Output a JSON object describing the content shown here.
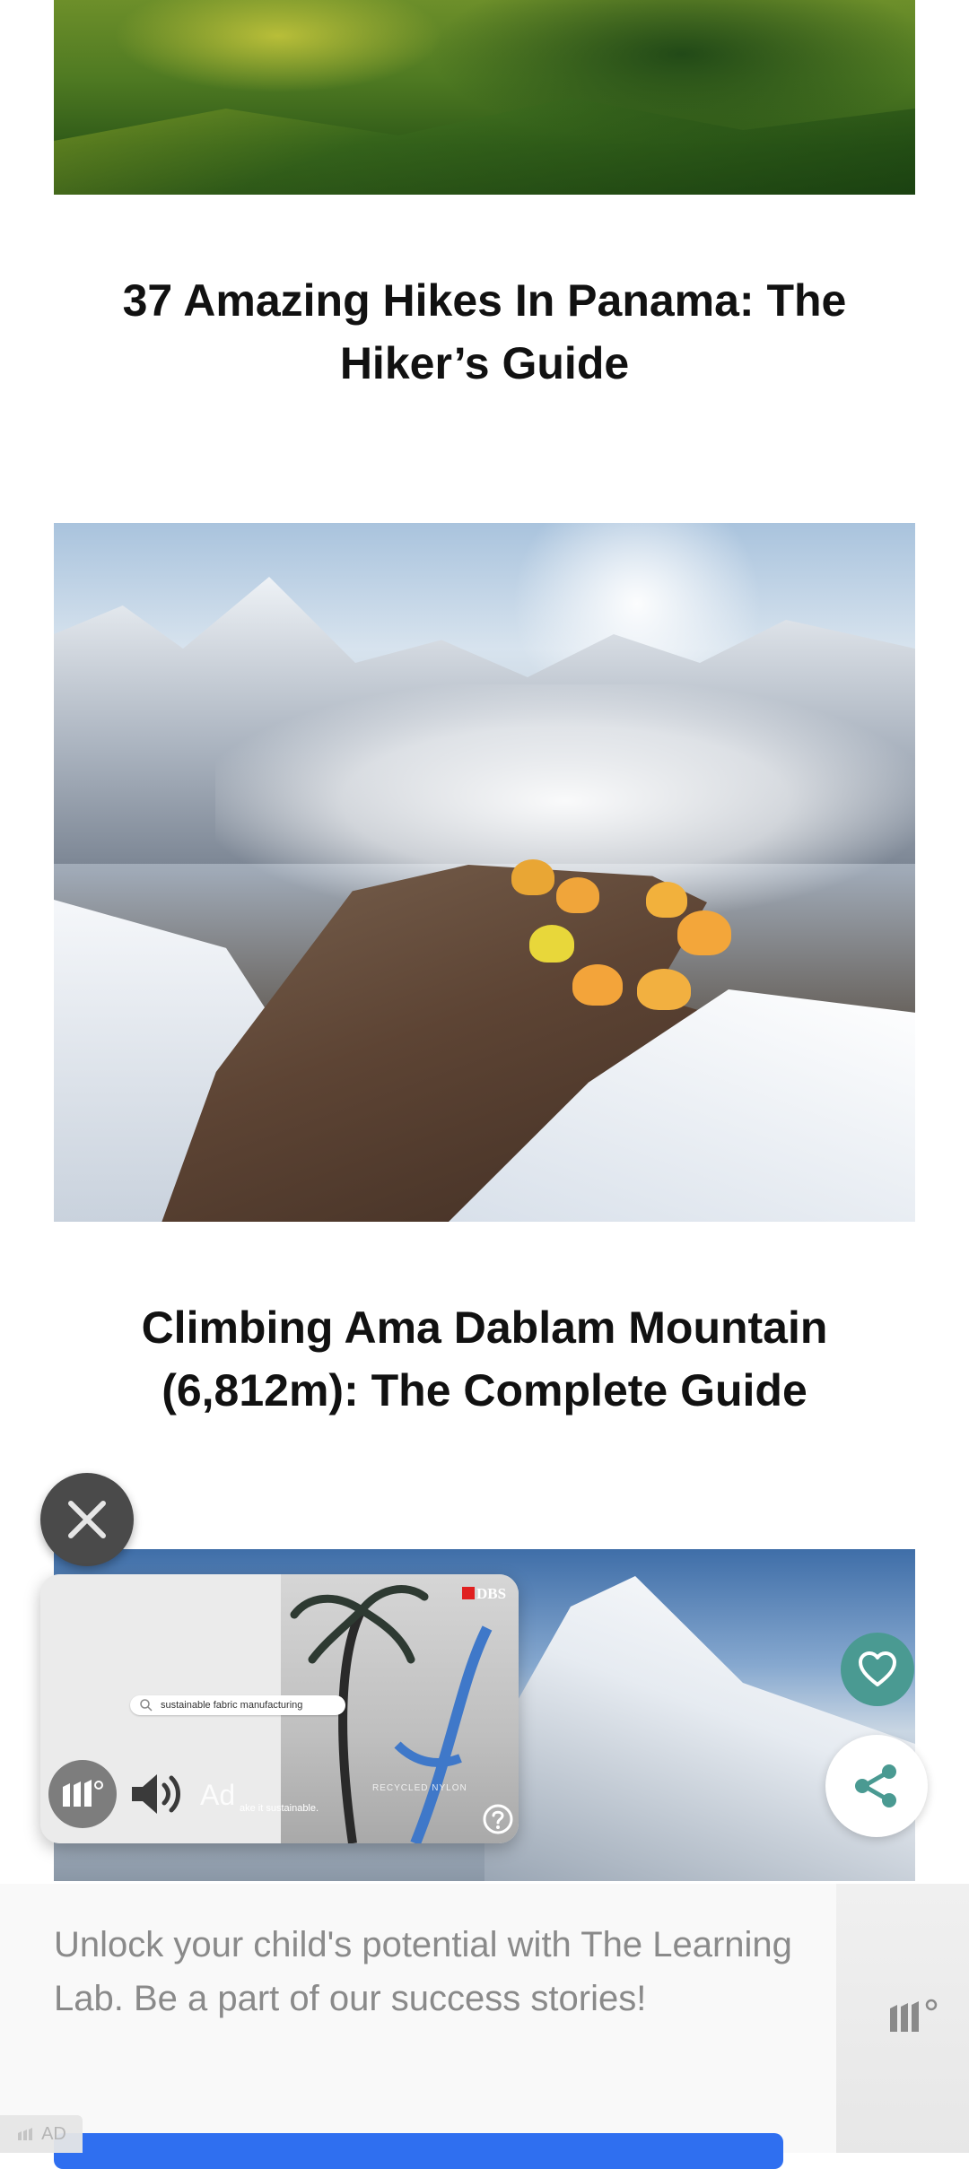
{
  "articles": [
    {
      "title": "37 Amazing Hikes In Panama: The Hiker’s Guide",
      "image": "green-hills-photo"
    },
    {
      "title": "Climbing Ama Dablam Mountain (6,812m): The Complete Guide",
      "image": "ama-dablam-camp-photo"
    }
  ],
  "video_ad": {
    "search_text": "sustainable fabric manufacturing",
    "brand": "DBS",
    "caption": "ake it sustainable.",
    "overlay_text": "RECYCLED NYLON",
    "ad_label": "Ad",
    "icons": [
      "close-icon",
      "brand-logo-icon",
      "speaker-icon",
      "help-icon"
    ]
  },
  "floating_actions": [
    {
      "name": "favorite",
      "icon": "heart-icon",
      "color": "#4a9a92"
    },
    {
      "name": "share",
      "icon": "share-icon",
      "color": "#4a9a92"
    }
  ],
  "banner_ad": {
    "text": "Unlock your child's potential with The Learning Lab. Be a part of our success stories!",
    "cta_color": "#2f6ff0",
    "tag": "AD"
  }
}
